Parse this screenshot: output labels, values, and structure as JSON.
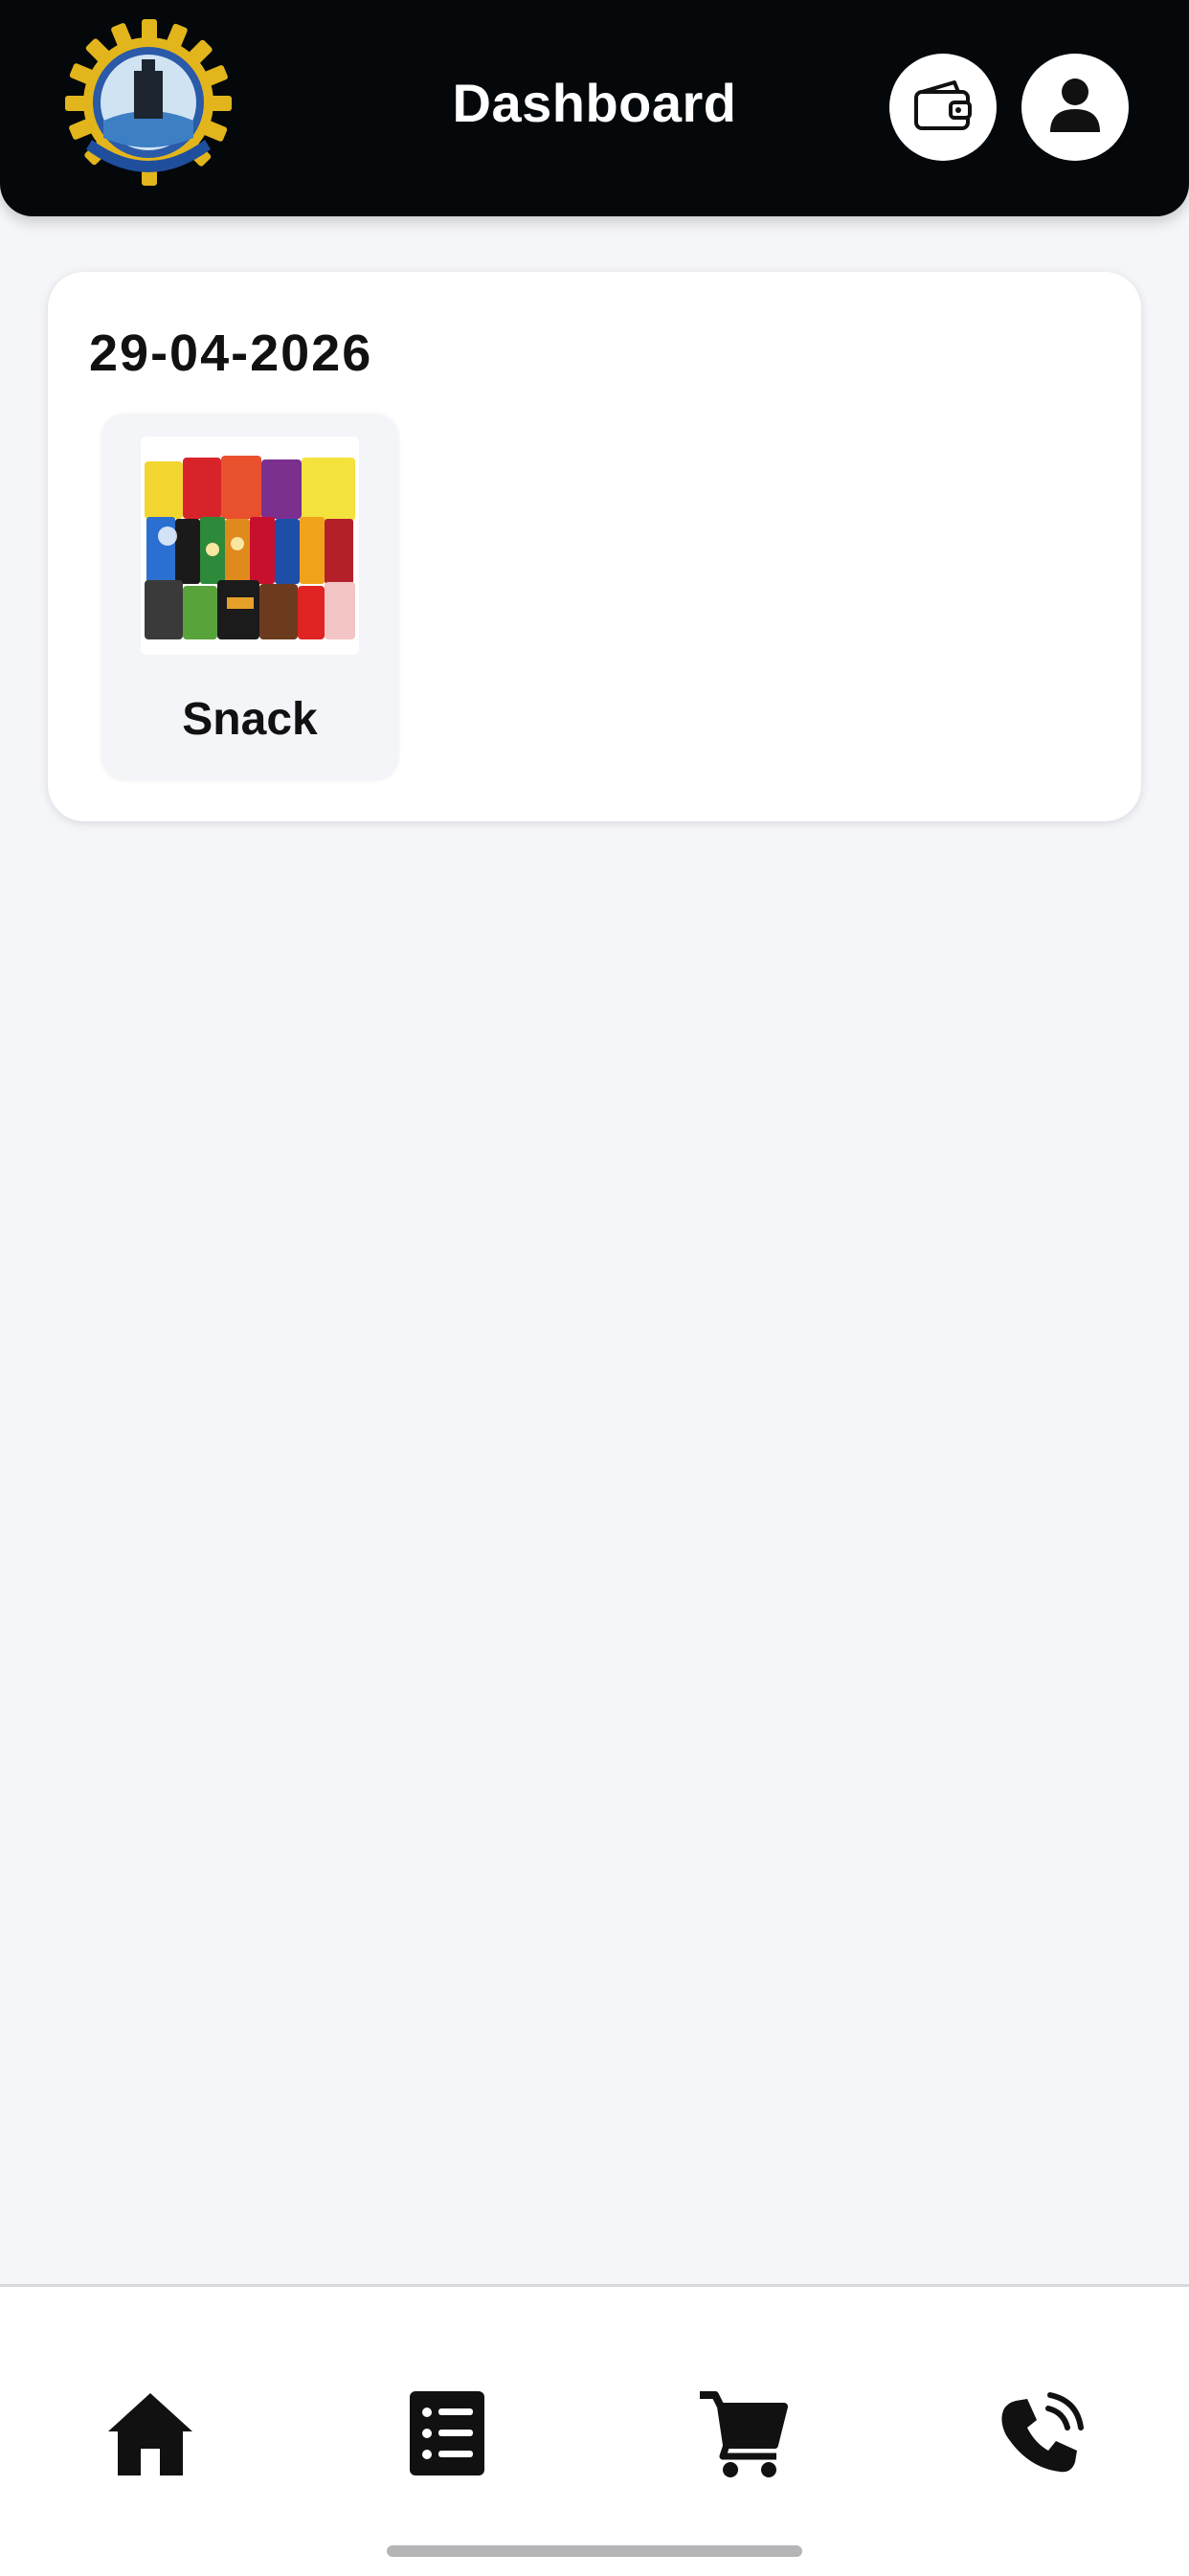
{
  "header": {
    "title": "Dashboard",
    "logo_icon": "crest-logo-icon",
    "wallet_icon": "wallet-icon",
    "profile_icon": "user-icon"
  },
  "day_card": {
    "date": "29-04-2026",
    "items": [
      {
        "label": "Snack",
        "image": "snack-assortment-image"
      }
    ]
  },
  "bottom_nav": {
    "items": [
      {
        "icon": "home-icon"
      },
      {
        "icon": "list-icon"
      },
      {
        "icon": "cart-icon"
      },
      {
        "icon": "phone-call-icon"
      }
    ]
  },
  "colors": {
    "header_bg": "#04080b",
    "page_bg": "#f5f6fa",
    "card_bg": "#ffffff",
    "tile_bg": "#f4f5f9",
    "icon_dark": "#111111"
  }
}
